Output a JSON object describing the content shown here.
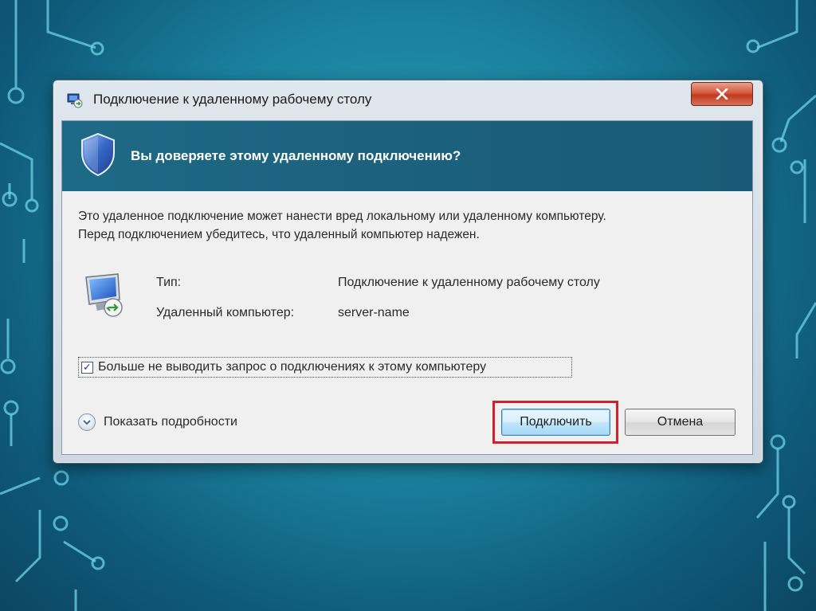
{
  "window": {
    "title": "Подключение к удаленному рабочему столу",
    "close_label": "x"
  },
  "banner": {
    "text": "Вы доверяете этому удаленному подключению?"
  },
  "description": {
    "line1": "Это удаленное подключение может нанести вред локальному или удаленному компьютеру.",
    "line2": "Перед подключением убедитесь, что удаленный компьютер надежен."
  },
  "info": {
    "type_label": "Тип:",
    "type_value": "Подключение к удаленному рабочему столу",
    "computer_label": "Удаленный компьютер:",
    "computer_value": "server-name"
  },
  "checkbox": {
    "label": "Больше не выводить запрос о подключениях к этому компьютеру",
    "checked": true,
    "checkmark": "✓"
  },
  "details": {
    "label": "Показать подробности"
  },
  "buttons": {
    "connect_label": "Подключить",
    "cancel_label": "Отмена"
  },
  "colors": {
    "banner": "#1e6a86",
    "highlight": "#d0202a",
    "close": "#c0391f"
  },
  "icons": {
    "app": "remote-desktop-icon",
    "banner": "shield-icon",
    "info": "monitor-icon",
    "details": "chevron-down-icon",
    "close": "close-icon"
  }
}
